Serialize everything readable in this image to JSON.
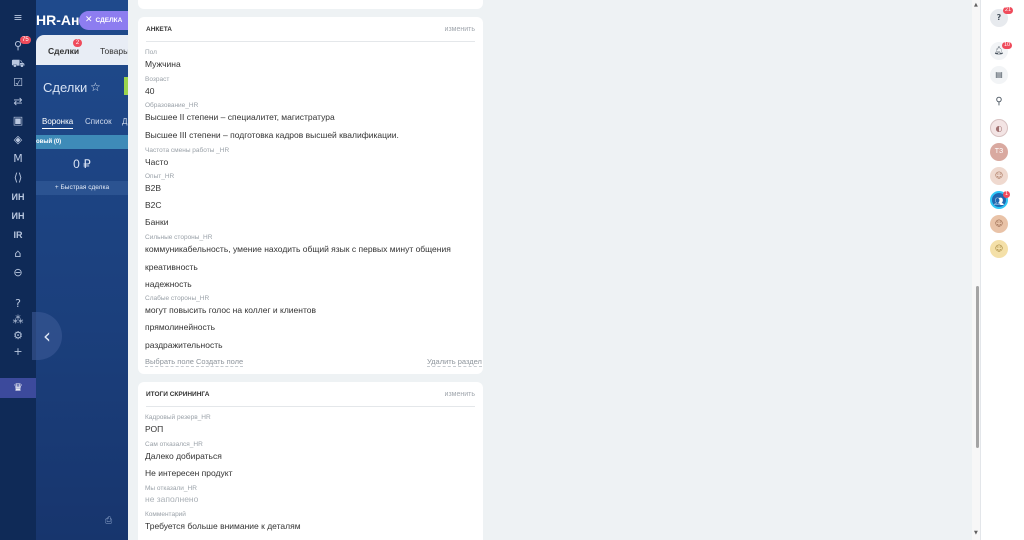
{
  "left_rail": {
    "filter_badge": "75",
    "items": [
      {
        "icon": "menu-icon",
        "glyph": "≡"
      },
      {
        "icon": "filter-icon",
        "glyph": "⚲"
      },
      {
        "icon": "cart-icon",
        "glyph": "⛟"
      },
      {
        "icon": "checkbox-icon",
        "glyph": "☑"
      },
      {
        "icon": "flow-icon",
        "glyph": "⇄"
      },
      {
        "icon": "contact-card-icon",
        "glyph": "▣"
      },
      {
        "icon": "layers-icon",
        "glyph": "◈"
      },
      {
        "icon": "m-logo-icon",
        "glyph": "M"
      },
      {
        "icon": "code-icon",
        "glyph": "⟨⟩"
      },
      {
        "icon": "building-icon",
        "glyph": "⌂"
      },
      {
        "icon": "minus-circle-icon",
        "glyph": "⊖"
      },
      {
        "icon": "help-icon",
        "glyph": "?"
      },
      {
        "icon": "sitemap-icon",
        "glyph": "⁂"
      },
      {
        "icon": "gear-icon",
        "glyph": "⚙"
      },
      {
        "icon": "plus-icon",
        "glyph": "+"
      },
      {
        "icon": "crown-icon",
        "glyph": "♛"
      }
    ],
    "text_items": [
      "ИН",
      "ИН",
      "IR"
    ]
  },
  "background_page": {
    "title": "HR-Ана",
    "tabs": [
      {
        "label": "Сделки",
        "badge": "2"
      },
      {
        "label": "Товары"
      }
    ],
    "heading": "Сделки",
    "subtabs": [
      "Воронка",
      "Список",
      "Д"
    ],
    "stage": "овый (0)",
    "sum": "0 ₽",
    "quick_deal": "Быстрая сделка"
  },
  "close_chip": {
    "label": "СДЕЛКА"
  },
  "form": {
    "section1": {
      "title": "Анкета",
      "edit": "изменить",
      "fields": [
        {
          "label": "Пол",
          "values": [
            "Мужчина"
          ]
        },
        {
          "label": "Возраст",
          "values": [
            "40"
          ]
        },
        {
          "label": "Образование_HR",
          "values": [
            "Высшее II степени – специалитет, магистратура",
            "Высшее III степени – подготовка кадров высшей квалификации."
          ]
        },
        {
          "label": "Частота смены работы _HR",
          "values": [
            "Часто"
          ]
        },
        {
          "label": "Опыт_HR",
          "values": [
            "B2B",
            "B2C",
            "Банки"
          ]
        },
        {
          "label": "Сильные стороны_HR",
          "values": [
            "коммуникабельность, умение находить общий язык с первых минут общения",
            "креативность",
            "надежность"
          ]
        },
        {
          "label": "Слабые стороны_HR",
          "values": [
            "могут повысить голос на коллег и клиентов",
            "прямолинейность",
            "раздражительность"
          ]
        }
      ],
      "choose_field": "Выбрать поле",
      "dot": "·",
      "create_field": "Создать поле",
      "delete_section": "Удалить раздел"
    },
    "section2": {
      "title": "Итоги скрининга",
      "edit": "изменить",
      "fields": [
        {
          "label": "Кадровый резерв_HR",
          "values": [
            "РОП"
          ]
        },
        {
          "label": "Сам отказался_HR",
          "values": [
            "Далеко добираться",
            "Не интересен продукт"
          ]
        },
        {
          "label": "Мы отказали_HR",
          "values": [
            "не заполнено"
          ]
        },
        {
          "label": "Комментарий",
          "values": [
            "Требуется больше внимание к деталям"
          ]
        }
      ]
    }
  },
  "right_rail": {
    "help_badge": "21",
    "bell_badge": "10",
    "chat_badge": "1",
    "avatar_initials": "ТЗ",
    "colors": {
      "accent": "#2fc6f6",
      "badge": "#ef4b5b",
      "avatar_tz": "#d9a9a0",
      "chat": "#2067b0"
    }
  }
}
